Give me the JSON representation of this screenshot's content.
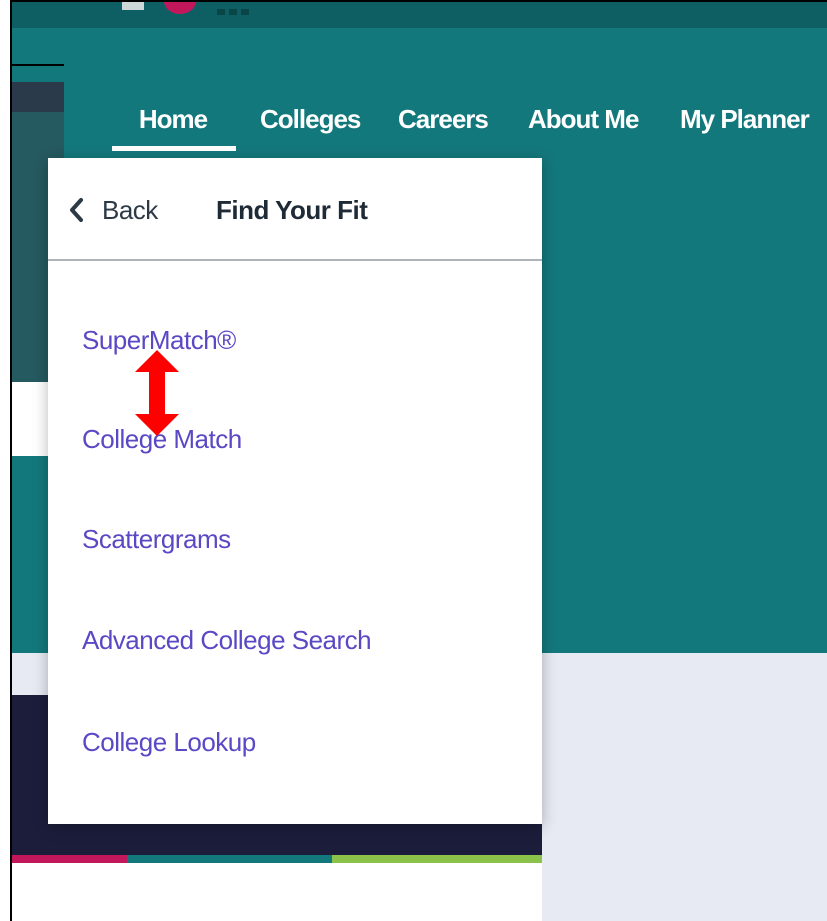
{
  "nav": {
    "items": [
      {
        "label": "Home",
        "active": true
      },
      {
        "label": "Colleges"
      },
      {
        "label": "Careers"
      },
      {
        "label": "About Me"
      },
      {
        "label": "My Planner"
      }
    ]
  },
  "dropdown": {
    "back_label": "Back",
    "title": "Find Your Fit",
    "items": [
      {
        "label": "SuperMatch®"
      },
      {
        "label": "College Match"
      },
      {
        "label": "Scattergrams"
      },
      {
        "label": "Advanced College Search"
      },
      {
        "label": "College Lookup"
      }
    ]
  },
  "icons": {
    "back": "chevron-left-icon",
    "annotation": "double-arrow-icon"
  },
  "colors": {
    "header_teal": "#13787c",
    "top_bar": "#0e5f63",
    "link_purple": "#5a48c4",
    "navy_card": "#1c1d3b",
    "magenta": "#c2185b",
    "green": "#8bc34a",
    "light_gray_background": "#e7eaf2",
    "annotation_red": "#ff0000"
  }
}
